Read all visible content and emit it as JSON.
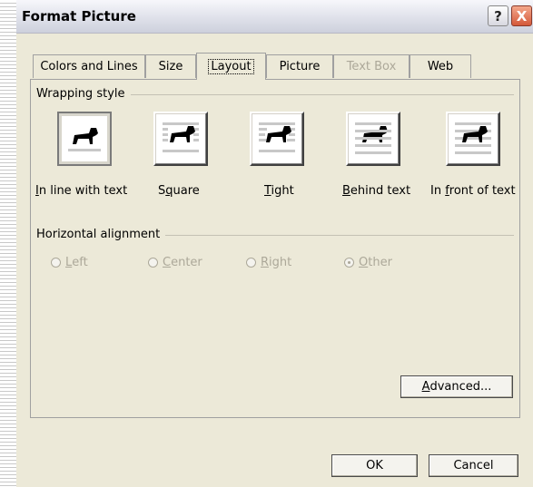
{
  "window": {
    "title": "Format Picture"
  },
  "titlebar": {
    "help_label": "?",
    "close_label": "X"
  },
  "tabs": [
    {
      "label": "Colors and Lines"
    },
    {
      "label": "Size"
    },
    {
      "label": "Layout"
    },
    {
      "label": "Picture"
    },
    {
      "label": "Text Box"
    },
    {
      "label": "Web"
    }
  ],
  "wrapping": {
    "group_label": "Wrapping style",
    "options": [
      {
        "label_ul": "I",
        "label_rest": "n line with text",
        "icon": "in-line-with-text-icon"
      },
      {
        "label_pre": "S",
        "label_ul": "q",
        "label_rest": "uare",
        "icon": "square-wrap-icon"
      },
      {
        "label_ul": "T",
        "label_rest": "ight",
        "icon": "tight-wrap-icon"
      },
      {
        "label_ul": "B",
        "label_rest": "ehind text",
        "icon": "behind-text-icon"
      },
      {
        "label_pre": "In ",
        "label_ul": "f",
        "label_rest": "ront of text",
        "icon": "in-front-of-text-icon"
      }
    ],
    "selected": "In line with text"
  },
  "alignment": {
    "group_label": "Horizontal alignment",
    "options": [
      {
        "label_ul": "L",
        "label_rest": "eft"
      },
      {
        "label_ul": "C",
        "label_rest": "enter"
      },
      {
        "label_ul": "R",
        "label_rest": "ight"
      },
      {
        "label_ul": "O",
        "label_rest": "ther"
      }
    ],
    "selected": "Other"
  },
  "buttons": {
    "advanced_ul": "A",
    "advanced_rest": "dvanced...",
    "ok": "OK",
    "cancel": "Cancel"
  },
  "colors": {
    "face": "#ece9d8",
    "disabled_text": "#aca899"
  }
}
